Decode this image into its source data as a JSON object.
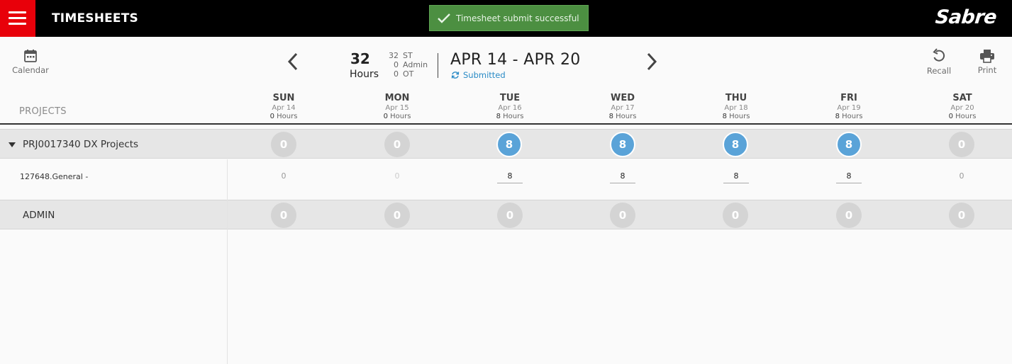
{
  "app": {
    "title": "TIMESHEETS",
    "logo": "Sabre"
  },
  "toast": {
    "message": "Timesheet submit successful"
  },
  "toolbar": {
    "calendar_label": "Calendar",
    "recall_label": "Recall",
    "print_label": "Print"
  },
  "summary": {
    "total": "32",
    "unit": "Hours",
    "breakdown": [
      {
        "value": "32",
        "label": "ST"
      },
      {
        "value": "0",
        "label": "Admin"
      },
      {
        "value": "0",
        "label": "OT"
      }
    ],
    "range": "APR 14 - APR 20",
    "status": "Submitted"
  },
  "table": {
    "projects_header": "PROJECTS",
    "days": [
      {
        "name": "SUN",
        "date": "Apr 14",
        "hours": "0",
        "hours_unit": "Hours"
      },
      {
        "name": "MON",
        "date": "Apr 15",
        "hours": "0",
        "hours_unit": "Hours"
      },
      {
        "name": "TUE",
        "date": "Apr 16",
        "hours": "8",
        "hours_unit": "Hours"
      },
      {
        "name": "WED",
        "date": "Apr 17",
        "hours": "8",
        "hours_unit": "Hours"
      },
      {
        "name": "THU",
        "date": "Apr 18",
        "hours": "8",
        "hours_unit": "Hours"
      },
      {
        "name": "FRI",
        "date": "Apr 19",
        "hours": "8",
        "hours_unit": "Hours"
      },
      {
        "name": "SAT",
        "date": "Apr 20",
        "hours": "0",
        "hours_unit": "Hours"
      }
    ],
    "project_group": {
      "name": "PRJ0017340 DX Projects",
      "totals": [
        "0",
        "0",
        "8",
        "8",
        "8",
        "8",
        "0"
      ]
    },
    "task": {
      "name": "127648.General -",
      "values": [
        "0",
        "0",
        "8",
        "8",
        "8",
        "8",
        "0"
      ]
    },
    "admin_group": {
      "name": "ADMIN",
      "totals": [
        "0",
        "0",
        "0",
        "0",
        "0",
        "0",
        "0"
      ]
    }
  },
  "colors": {
    "topbar": "#000000",
    "menu_button": "#e8000a",
    "toast": "#4c8f41",
    "accent_blue": "#5aa3d8",
    "status_blue": "#2a8bc6"
  }
}
